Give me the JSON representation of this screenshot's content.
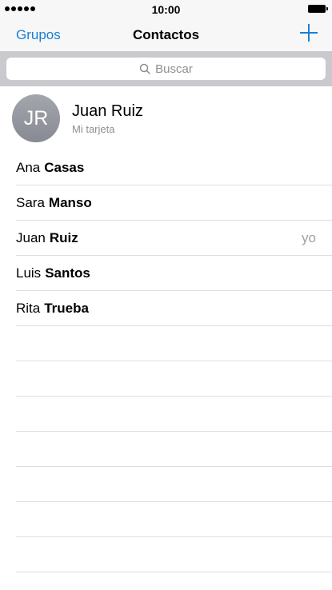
{
  "status_bar": {
    "time": "10:00"
  },
  "nav": {
    "left_label": "Grupos",
    "title": "Contactos",
    "add_icon": "plus-icon"
  },
  "search": {
    "placeholder": "Buscar"
  },
  "my_card": {
    "initials": "JR",
    "name": "Juan Ruiz",
    "subtitle": "Mi tarjeta"
  },
  "contacts": [
    {
      "first": "Ana",
      "last": "Casas",
      "tag": ""
    },
    {
      "first": "Sara",
      "last": "Manso",
      "tag": ""
    },
    {
      "first": "Juan",
      "last": "Ruiz",
      "tag": "yo"
    },
    {
      "first": "Luis",
      "last": "Santos",
      "tag": ""
    },
    {
      "first": "Rita",
      "last": "Trueba",
      "tag": ""
    }
  ],
  "colors": {
    "accent": "#1a7fd4",
    "search_bg": "#c9c9ce",
    "separator": "#dedede"
  }
}
